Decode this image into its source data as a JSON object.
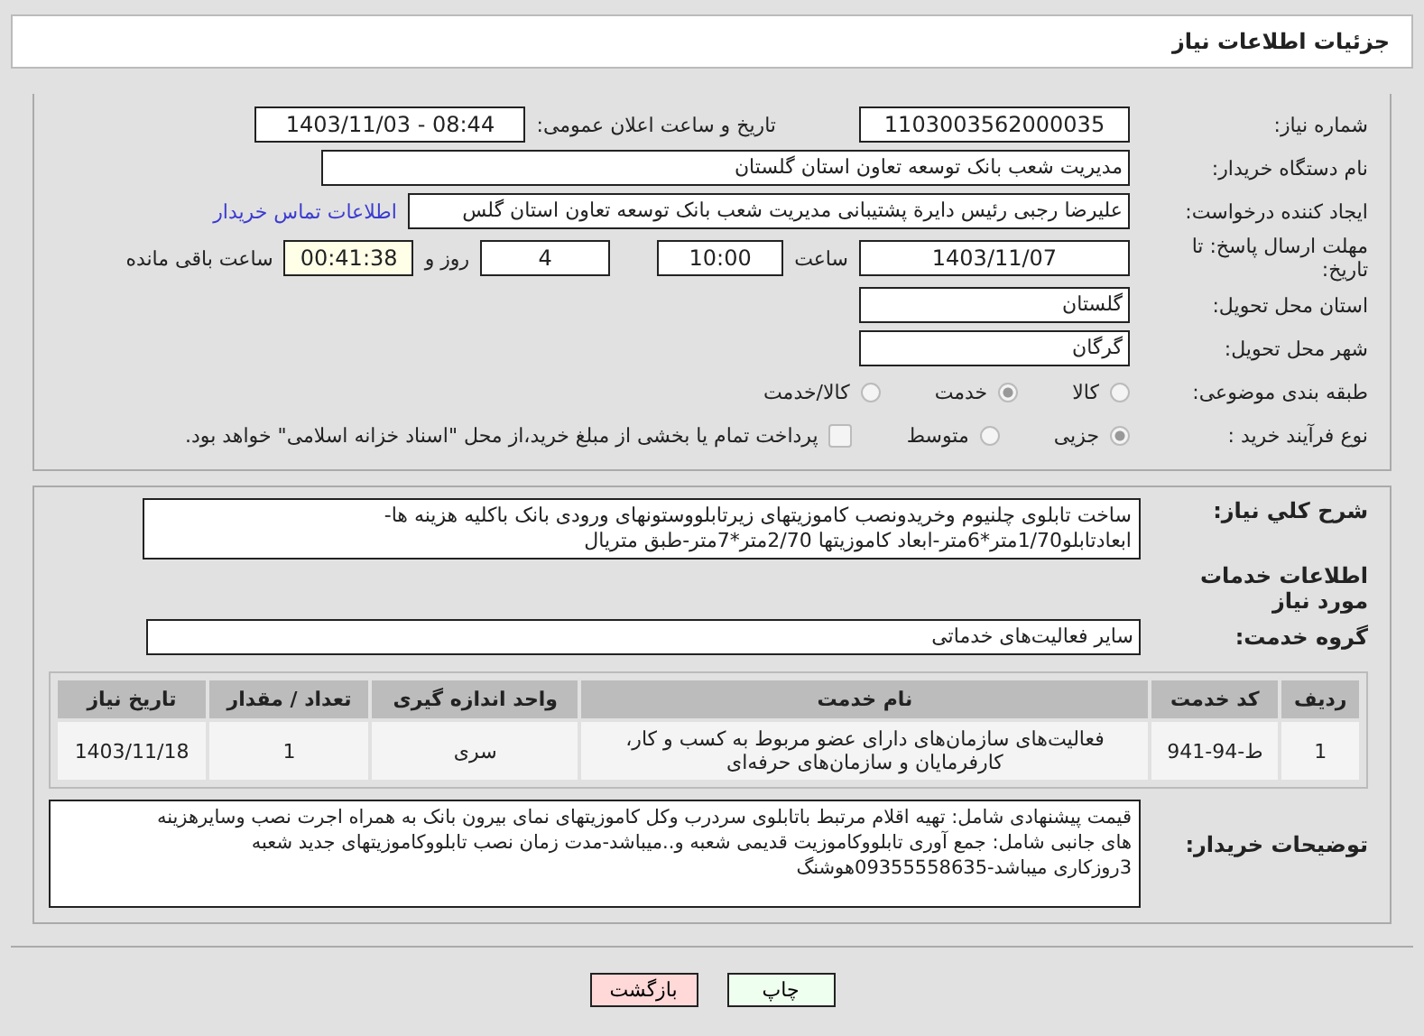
{
  "header": {
    "title": "جزئیات اطلاعات نیاز"
  },
  "details": {
    "need_number": {
      "label": "شماره نیاز:",
      "value": "1103003562000035"
    },
    "announce": {
      "label": "تاریخ و ساعت اعلان عمومی:",
      "value": "1403/11/03 - 08:44"
    },
    "buyer_org": {
      "label": "نام دستگاه خریدار:",
      "value": "مدیریت شعب بانک توسعه تعاون استان گلستان"
    },
    "requester": {
      "label": "ایجاد کننده درخواست:",
      "value": "علیرضا رجبی رئیس دایرة پشتیبانی مدیریت شعب بانک توسعه تعاون استان گلس",
      "contact_link": "اطلاعات تماس خریدار"
    },
    "deadline": {
      "label": "مهلت ارسال پاسخ: تا تاریخ:",
      "date": "1403/11/07",
      "time_label": "ساعت",
      "time": "10:00",
      "days": "4",
      "days_label": "روز و",
      "remaining": "00:41:38",
      "remaining_label": "ساعت باقی مانده"
    },
    "province": {
      "label": "استان محل تحویل:",
      "value": "گلستان"
    },
    "city": {
      "label": "شهر محل تحویل:",
      "value": "گرگان"
    },
    "category": {
      "label": "طبقه بندی موضوعی:",
      "options": [
        {
          "label": "کالا",
          "selected": false
        },
        {
          "label": "خدمت",
          "selected": true
        },
        {
          "label": "کالا/خدمت",
          "selected": false
        }
      ]
    },
    "purchase_type": {
      "label": "نوع فرآیند خرید :",
      "options": [
        {
          "label": "جزیی",
          "selected": true
        },
        {
          "label": "متوسط",
          "selected": false
        }
      ],
      "treasury": {
        "label": "پرداخت تمام یا بخشی از مبلغ خرید،از محل \"اسناد خزانه اسلامی\" خواهد بود.",
        "checked": false
      }
    }
  },
  "summary": {
    "label": "شرح کلي نياز:",
    "text": "ساخت تابلوی چلنیوم وخریدونصب کاموزیتهای زیرتابلووستونهای ورودی بانک باکلیه هزینه ها-\nابعادتابلو1/70متر*6متر-ابعاد کاموزیتها 2/70متر*7متر-طبق متریال"
  },
  "services": {
    "heading": "اطلاعات خدمات مورد نیاز",
    "group_label": "گروه خدمت:",
    "group_value": "سایر فعالیت‌های خدماتی",
    "table": {
      "columns": [
        "ردیف",
        "کد خدمت",
        "نام خدمت",
        "واحد اندازه گیری",
        "تعداد / مقدار",
        "تاریخ نیاز"
      ],
      "rows": [
        [
          "1",
          "ط-94-941",
          "فعالیت‌های سازمان‌های دارای عضو مربوط به کسب و کار،\nکارفرمایان و سازمان‌های حرفه‌ای",
          "سری",
          "1",
          "1403/11/18"
        ]
      ]
    }
  },
  "buyer_notes": {
    "label": "توضیحات خریدار:",
    "text": "قیمت پیشنهادی شامل: تهیه اقلام مرتبط باتابلوی سردرب وکل کاموزیتهای نمای بیرون بانک به همراه اجرت نصب وسایرهزینه\nهای جانبی شامل: جمع آوری تابلووکاموزیت قدیمی شعبه و..میباشد-مدت زمان نصب تابلووکاموزیتهای جدید شعبه\n3روزکاری میباشد-09355558635هوشنگ"
  },
  "buttons": [
    {
      "label": "چاپ",
      "kind": "print"
    },
    {
      "label": "بازگشت",
      "kind": "back"
    }
  ]
}
